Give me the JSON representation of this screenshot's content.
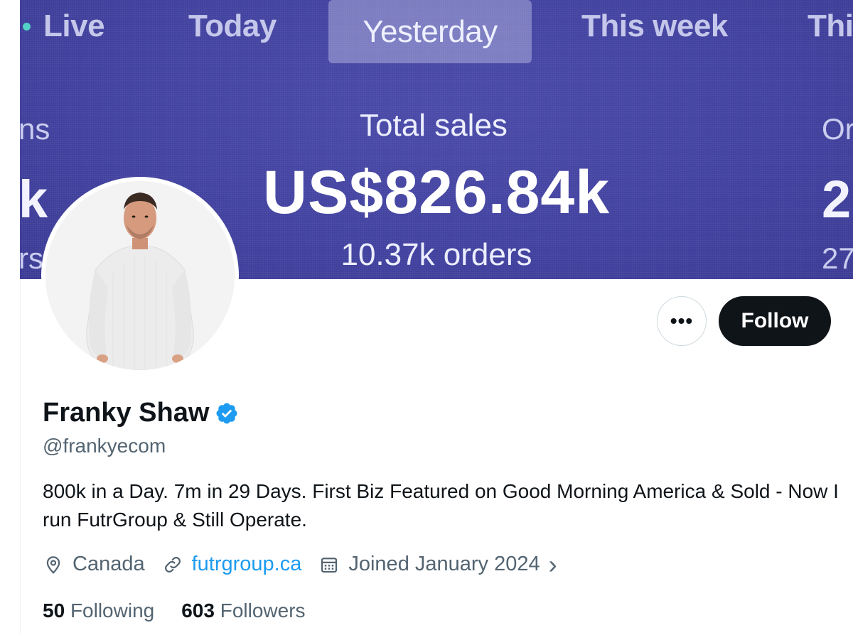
{
  "banner": {
    "tabs": [
      "Live",
      "Today",
      "Yesterday",
      "This week",
      "Thi"
    ],
    "left_partial": [
      "ns",
      "k",
      "rs"
    ],
    "right_partial": [
      "Or",
      "2",
      "27"
    ],
    "title": "Total sales",
    "amount": "US$826.84k",
    "orders": "10.37k orders"
  },
  "actions": {
    "more_label": "•••",
    "follow_label": "Follow"
  },
  "profile": {
    "name": "Franky Shaw",
    "handle": "@frankyecom",
    "bio": "800k in a Day. 7m in 29 Days. First Biz Featured on Good Morning America & Sold - Now I run FutrGroup & Still Operate.",
    "location": "Canada",
    "website": "futrgroup.ca",
    "joined": "Joined January 2024",
    "chevron": "›",
    "following_count": "50",
    "following_label": "Following",
    "followers_count": "603",
    "followers_label": "Followers"
  },
  "colors": {
    "banner": "#4242a0",
    "verified": "#1d9bf0",
    "link": "#1d9bf0",
    "follow_button": "#0f1419"
  },
  "icons": [
    "location-pin-icon",
    "link-icon",
    "calendar-icon",
    "chevron-right-icon",
    "verified-badge-icon",
    "more-icon"
  ]
}
